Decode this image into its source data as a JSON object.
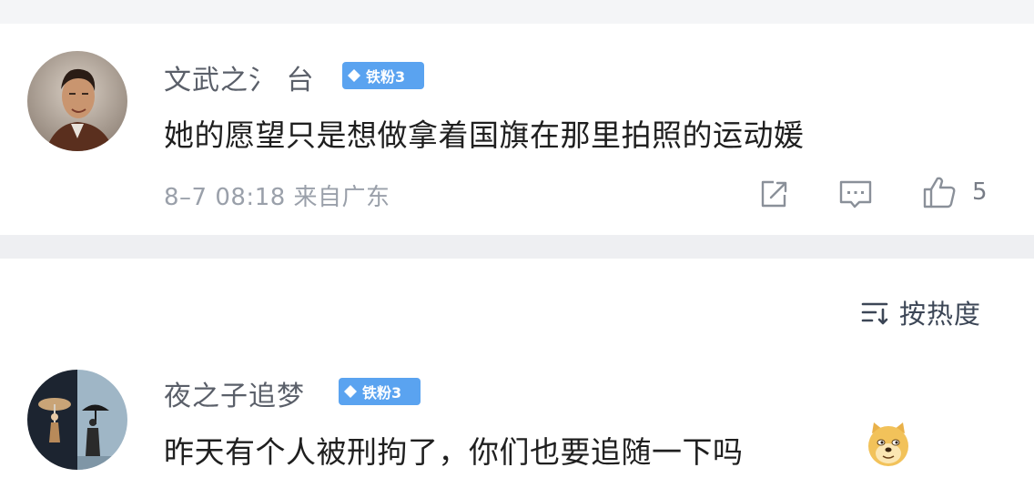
{
  "comments": [
    {
      "username": "文武之氵 台",
      "badge": "铁粉3",
      "text": "她的愿望只是想做拿着国旗在那里拍照的运动媛",
      "meta": "8–7 08:18 来自广东",
      "likes": "5"
    },
    {
      "username": "夜之子追梦",
      "badge": "铁粉3",
      "text": "昨天有个人被刑拘了，你们也要追随一下吗"
    }
  ],
  "sort": {
    "label": "按热度"
  },
  "colors": {
    "badge": "#5aa3f0",
    "meta": "#9aa0aa",
    "separator": "#eeeff2"
  },
  "icons": [
    "share-icon",
    "reply-icon",
    "like-icon",
    "sort-icon",
    "doge-emoji-icon"
  ]
}
